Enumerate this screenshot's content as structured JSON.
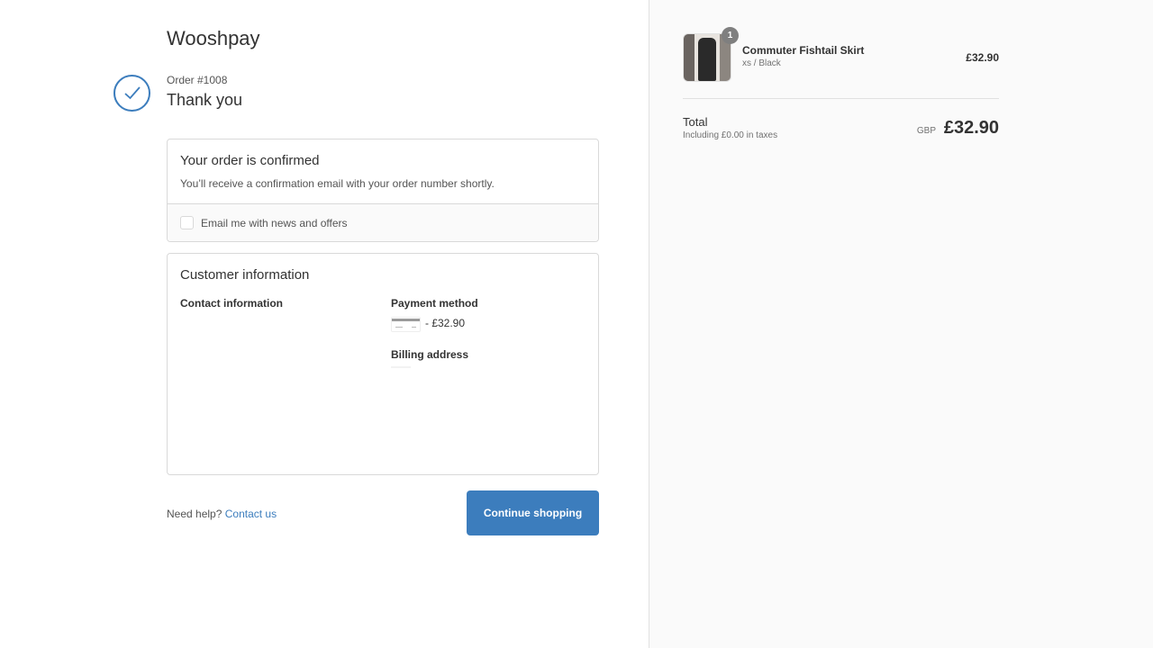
{
  "store": {
    "name": "Wooshpay"
  },
  "order": {
    "number": "Order #1008",
    "greeting": "Thank you"
  },
  "confirmed": {
    "title": "Your order is confirmed",
    "description": "You’ll receive a confirmation email with your order number shortly.",
    "news_label": "Email me with news and offers",
    "news_checked": false
  },
  "customer": {
    "title": "Customer information",
    "contact_label": "Contact information",
    "payment_label": "Payment method",
    "payment_amount": "- £32.90",
    "billing_label": "Billing address"
  },
  "footer": {
    "need_help": "Need help?",
    "contact_link": "Contact us",
    "continue_label": "Continue shopping"
  },
  "summary": {
    "product": {
      "name": "Commuter Fishtail Skirt",
      "variant": "xs / Black",
      "price": "£32.90",
      "quantity": "1"
    },
    "total_label": "Total",
    "taxes_note": "Including £0.00 in taxes",
    "currency": "GBP",
    "total_amount": "£32.90"
  },
  "colors": {
    "accent": "#3c7dbd",
    "sidebar_bg": "#fafafa",
    "border": "#d9d9d9"
  },
  "icons": {
    "success": "check-circle-icon",
    "card": "credit-card-icon"
  }
}
